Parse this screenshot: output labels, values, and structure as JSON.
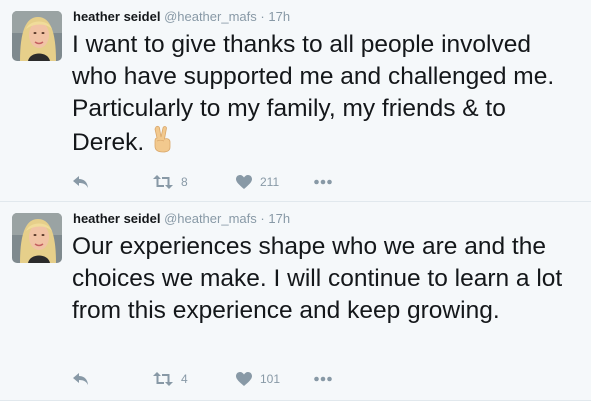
{
  "tweets": [
    {
      "author_name": "heather seidel",
      "handle": "@heather_mafs",
      "separator": "·",
      "time": "17h",
      "text": "I want to give thanks to all people involved who have supported me and challenged me. Particularly to my family, my friends & to Derek.",
      "emoji": "victory-hand-icon",
      "retweets": "8",
      "likes": "211"
    },
    {
      "author_name": "heather seidel",
      "handle": "@heather_mafs",
      "separator": "·",
      "time": "17h",
      "text": "Our experiences shape who we are and the choices we make. I will continue to learn a lot from this experience and keep growing.",
      "retweets": "4",
      "likes": "101"
    }
  ],
  "colors": {
    "background": "#f5f8fa",
    "muted": "#8899a6",
    "text": "#14171a",
    "border": "#e1e8ed"
  }
}
